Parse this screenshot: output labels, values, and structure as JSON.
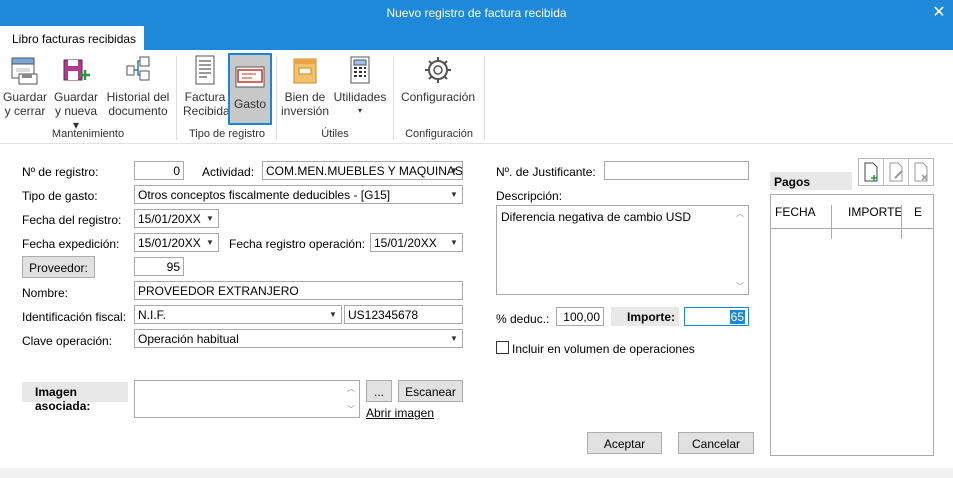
{
  "window": {
    "title": "Nuevo registro de factura recibida",
    "close_glyph": "✕"
  },
  "tab": {
    "label": "Libro facturas recibidas"
  },
  "ribbon": {
    "groups": [
      {
        "label": "Mantenimiento"
      },
      {
        "label": "Tipo de registro"
      },
      {
        "label": "Útiles"
      },
      {
        "label": "Configuración"
      }
    ],
    "buttons": {
      "guardar_cerrar": [
        "Guardar",
        "y cerrar"
      ],
      "guardar_nueva": [
        "Guardar",
        "y nueva ▾"
      ],
      "historial": [
        "Historial del",
        "documento"
      ],
      "factura_recibida": [
        "Factura",
        "Recibida"
      ],
      "gasto": [
        "Gasto"
      ],
      "bien_inversion": [
        "Bien de",
        "inversión"
      ],
      "utilidades": [
        "Utilidades",
        "▾"
      ],
      "configuracion": [
        "Configuración"
      ]
    }
  },
  "form": {
    "n_registro": {
      "label": "Nº de registro:",
      "value": "0"
    },
    "actividad": {
      "label": "Actividad:",
      "value": "COM.MEN.MUEBLES Y MAQUINAS ["
    },
    "tipo_gasto": {
      "label": "Tipo de gasto:",
      "value": "Otros conceptos fiscalmente deducibles - [G15]"
    },
    "fecha_registro": {
      "label": "Fecha del registro:",
      "value": "15/01/20XX"
    },
    "fecha_expedicion": {
      "label": "Fecha expedición:",
      "value": "15/01/20XX"
    },
    "fecha_reg_operacion": {
      "label": "Fecha registro operación:",
      "value": "15/01/20XX"
    },
    "proveedor": {
      "button_label": "Proveedor:",
      "value": "95"
    },
    "nombre": {
      "label": "Nombre:",
      "value": "PROVEEDOR EXTRANJERO"
    },
    "id_fiscal": {
      "label": "Identificación fiscal:",
      "type_value": "N.I.F.",
      "value": "US12345678"
    },
    "clave_operacion": {
      "label": "Clave operación:",
      "value": "Operación habitual"
    },
    "imagen": {
      "label": "Imagen asociada:",
      "browse_label": "...",
      "scan_label": "Escanear",
      "open_link": "Abrir imagen"
    },
    "justificante": {
      "label": "Nº. de Justificante:",
      "value": ""
    },
    "descripcion": {
      "label": "Descripción:",
      "value": "Diferencia negativa de cambio USD"
    },
    "deduc": {
      "label": "% deduc.:",
      "value": "100,00"
    },
    "importe": {
      "label": "Importe:",
      "value": "65"
    },
    "incluir": {
      "label": "Incluir en  volumen de operaciones",
      "checked": false
    }
  },
  "pagos": {
    "title": "Pagos",
    "columns": [
      "FECHA",
      "IMPORTE",
      "E"
    ]
  },
  "actions": {
    "accept": "Aceptar",
    "cancel": "Cancelar"
  },
  "colors": {
    "accent": "#1e88d9",
    "active_border": "#1c86d6"
  }
}
